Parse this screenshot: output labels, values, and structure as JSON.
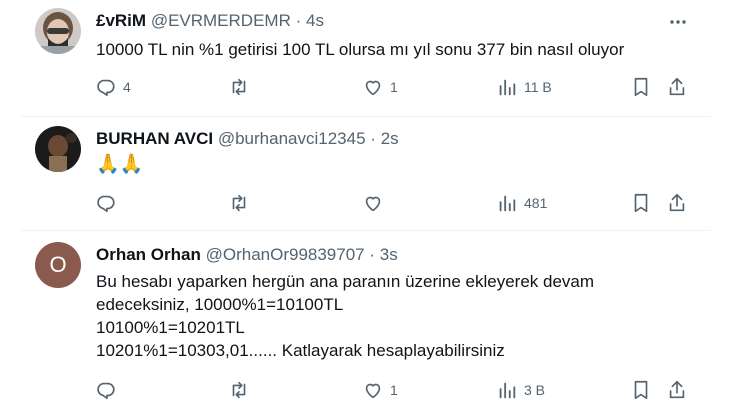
{
  "tweets": [
    {
      "name": "£vRiM",
      "handle": "@EVRMERDEMR",
      "dot": "·",
      "time": "4s",
      "lines": [
        "10000 TL nin %1 getirisi 100 TL olursa mı yıl sonu 377 bin nasıl oluyor"
      ],
      "replies": "4",
      "retweets": "",
      "likes": "1",
      "views": "11 B"
    },
    {
      "name": "BURHAN AVCI",
      "handle": "@burhanavci12345",
      "dot": "·",
      "time": "2s",
      "lines": [
        "🙏🙏"
      ],
      "replies": "",
      "retweets": "",
      "likes": "",
      "views": "481"
    },
    {
      "name": "Orhan Orhan",
      "handle": "@OrhanOr99839707",
      "dot": "·",
      "time": "3s",
      "avatar_letter": "O",
      "lines": [
        "Bu hesabı yaparken hergün ana paranın üzerine ekleyerek devam",
        "edeceksiniz, 10000%1=10100TL",
        "10100%1=10201TL",
        "10201%1=10303,01...... Katlayarak hesaplayabilirsiniz"
      ],
      "replies": "",
      "retweets": "",
      "likes": "1",
      "views": "3 B"
    }
  ],
  "colors": {
    "icon": "#536471",
    "avatar_orhan": "#8b5a4e",
    "divider": "#eff3f4"
  }
}
